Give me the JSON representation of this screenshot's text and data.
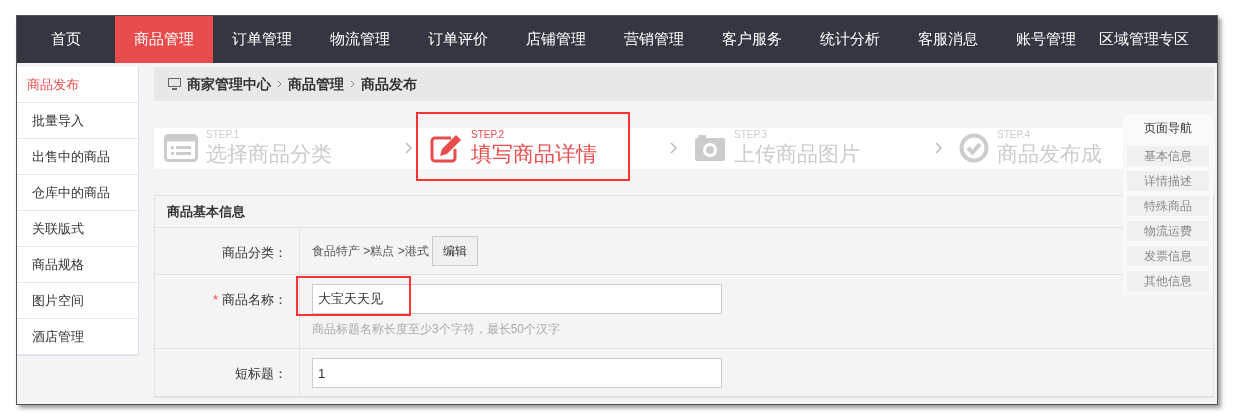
{
  "top_nav": [
    {
      "label": "首页",
      "selected": false
    },
    {
      "label": "商品管理",
      "selected": true
    },
    {
      "label": "订单管理",
      "selected": false
    },
    {
      "label": "物流管理",
      "selected": false
    },
    {
      "label": "订单评价",
      "selected": false
    },
    {
      "label": "店铺管理",
      "selected": false
    },
    {
      "label": "营销管理",
      "selected": false
    },
    {
      "label": "客户服务",
      "selected": false
    },
    {
      "label": "统计分析",
      "selected": false
    },
    {
      "label": "客服消息",
      "selected": false
    },
    {
      "label": "账号管理",
      "selected": false
    },
    {
      "label": "区域管理专区",
      "selected": false
    }
  ],
  "sidebar": {
    "items": [
      {
        "label": "商品发布",
        "selected": true
      },
      {
        "label": "批量导入",
        "selected": false
      },
      {
        "label": "出售中的商品",
        "selected": false
      },
      {
        "label": "仓库中的商品",
        "selected": false
      },
      {
        "label": "关联版式",
        "selected": false
      },
      {
        "label": "商品规格",
        "selected": false
      },
      {
        "label": "图片空间",
        "selected": false
      },
      {
        "label": "酒店管理",
        "selected": false
      }
    ]
  },
  "breadcrumb": [
    "商家管理中心",
    "商品管理",
    "商品发布"
  ],
  "steps": [
    {
      "kind": "list",
      "step": "STEP.1",
      "label": "选择商品分类",
      "selected": false,
      "highlighted": false
    },
    {
      "kind": "edit",
      "step": "STEP.2",
      "label": "填写商品详情",
      "selected": true,
      "highlighted": true
    },
    {
      "kind": "camera",
      "step": "STEP.3",
      "label": "上传商品图片",
      "selected": false,
      "highlighted": false
    },
    {
      "kind": "check",
      "step": "STEP.4",
      "label": "商品发布成",
      "selected": false,
      "highlighted": false
    }
  ],
  "form": {
    "title": "商品基本信息",
    "rows": [
      {
        "kind": "category",
        "label": "商品分类：",
        "value": "食品特产 >糕点 >港式",
        "button": "编辑"
      },
      {
        "kind": "input",
        "label": "商品名称：",
        "required_mark": "*",
        "value": "大宝天天见",
        "hint": "商品标题名称长度至少3个字符，最长50个汉字",
        "highlighted": true
      },
      {
        "kind": "input",
        "label": "短标题：",
        "value": "1",
        "highlighted": false
      }
    ]
  },
  "page_nav": {
    "title": "页面导航",
    "items": [
      "基本信息",
      "详情描述",
      "特殊商品",
      "物流运费",
      "发票信息",
      "其他信息"
    ]
  }
}
